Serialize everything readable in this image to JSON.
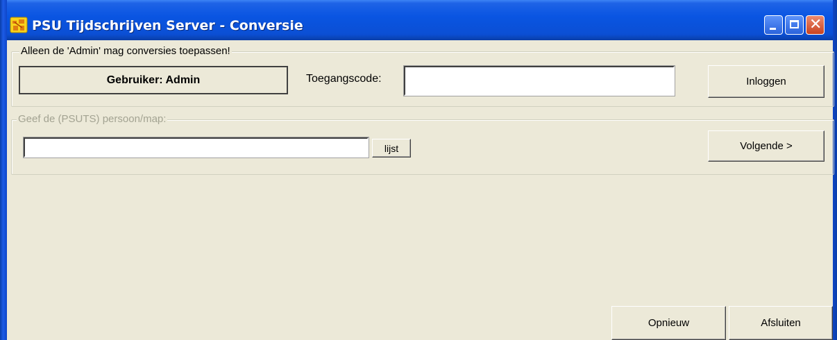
{
  "window": {
    "title": "PSU Tijdschrijven Server - Conversie",
    "controls": {
      "minimize": "minimize-icon",
      "maximize": "maximize-icon",
      "close": "close-icon"
    },
    "accent": "#0a55e2"
  },
  "login_group": {
    "legend": "Alleen de 'Admin' mag conversies toepassen!",
    "user_label": "Gebruiker: Admin",
    "code_label": "Toegangscode:",
    "code_value": "",
    "login_button": "Inloggen"
  },
  "person_group": {
    "legend": "Geef de (PSUTS) persoon/map:",
    "person_value": "",
    "list_button": "lijst",
    "next_button": "Volgende >"
  },
  "footer": {
    "reset_button": "Opnieuw",
    "close_button": "Afsluiten"
  }
}
